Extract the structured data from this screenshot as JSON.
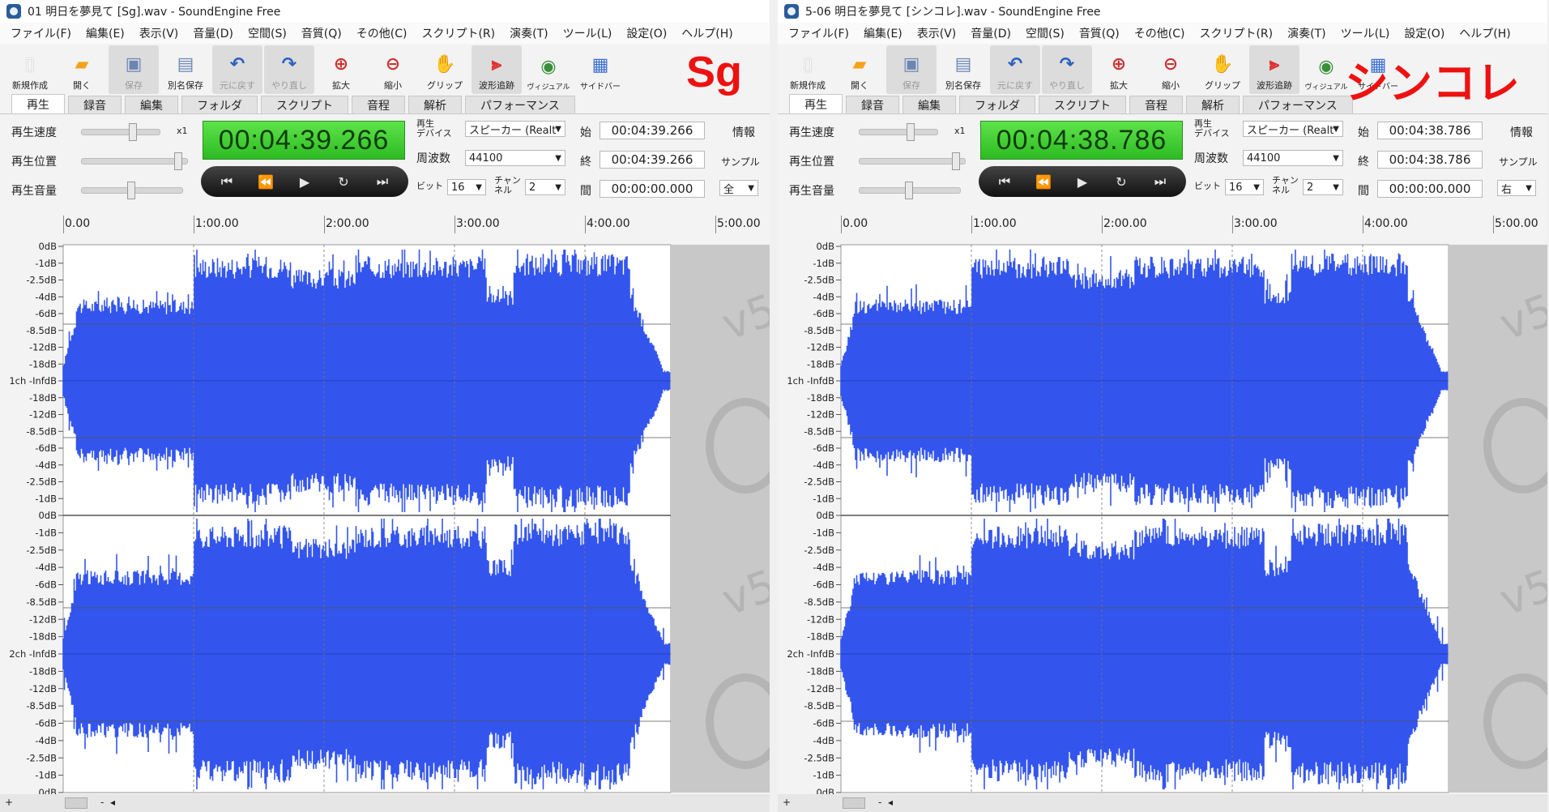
{
  "left": {
    "title": "01 明日を夢見て [Sg].wav - SoundEngine Free",
    "label": "Sg",
    "time_display": "00:04:39.266",
    "start": "00:04:39.266",
    "end": "00:04:39.266",
    "interval": "00:00:00.000",
    "channel_mode": "全"
  },
  "right": {
    "title": "5-06 明日を夢見て [シンコレ].wav - SoundEngine Free",
    "label": "シンコレ",
    "time_display": "00:04:38.786",
    "start": "00:04:38.786",
    "end": "00:04:38.786",
    "interval": "00:00:00.000",
    "channel_mode": "右"
  },
  "menu": [
    "ファイル(F)",
    "編集(E)",
    "表示(V)",
    "音量(D)",
    "空間(S)",
    "音質(Q)",
    "その他(C)",
    "スクリプト(R)",
    "演奏(T)",
    "ツール(L)",
    "設定(O)",
    "ヘルプ(H)"
  ],
  "toolbar": {
    "new": "新規作成",
    "open": "開く",
    "save": "保存",
    "save_as": "別名保存",
    "undo": "元に戻す",
    "redo": "やり直し",
    "zoom_in": "拡大",
    "zoom_out": "縮小",
    "grip": "グリップ",
    "wave_follow": "波形追跡",
    "visual": "ヴィジュアル",
    "sidebar": "サイドバー"
  },
  "tabs": [
    "再生",
    "録音",
    "編集",
    "フォルダ",
    "スクリプト",
    "音程",
    "解析",
    "パフォーマンス"
  ],
  "controls": {
    "speed_label": "再生速度",
    "speed_value": "x1",
    "position_label": "再生位置",
    "volume_label": "再生音量",
    "device_label": "再生\nデバイス",
    "device_value": "スピーカー (Realt",
    "freq_label": "周波数",
    "freq_value": "44100",
    "bit_label": "ビット",
    "bit_value": "16",
    "channel_label": "チャン\nネル",
    "channel_value": "2",
    "start_label": "始",
    "end_label": "終",
    "interval_label": "間",
    "info_label": "情報",
    "sample_label": "サンプル"
  },
  "transport": [
    "⏮",
    "⏪",
    "▶",
    "↻",
    "⏭"
  ],
  "ruler": [
    "0.00",
    "1:00.00",
    "2:00.00",
    "3:00.00",
    "4:00.00",
    "5:00.00"
  ],
  "db_labels_top": [
    "0dB",
    "-1dB",
    "-2.5dB",
    "-4dB",
    "-6dB",
    "-8.5dB",
    "-12dB",
    "-18dB",
    "1ch -InfdB",
    "-18dB",
    "-12dB",
    "-8.5dB",
    "-6dB",
    "-4dB",
    "-2.5dB",
    "-1dB",
    "0dB"
  ],
  "db_labels_bottom": [
    "-1dB",
    "-2.5dB",
    "-4dB",
    "-6dB",
    "-8.5dB",
    "-12dB",
    "-18dB",
    "2ch -InfdB",
    "-18dB",
    "-12dB",
    "-8.5dB",
    "-6dB",
    "-4dB",
    "-2.5dB",
    "-1dB",
    "0dB"
  ],
  "watermark": "v5",
  "colors": {
    "wave": "#3355ee",
    "label": "#ee1111",
    "time_bg": "#43d136"
  }
}
